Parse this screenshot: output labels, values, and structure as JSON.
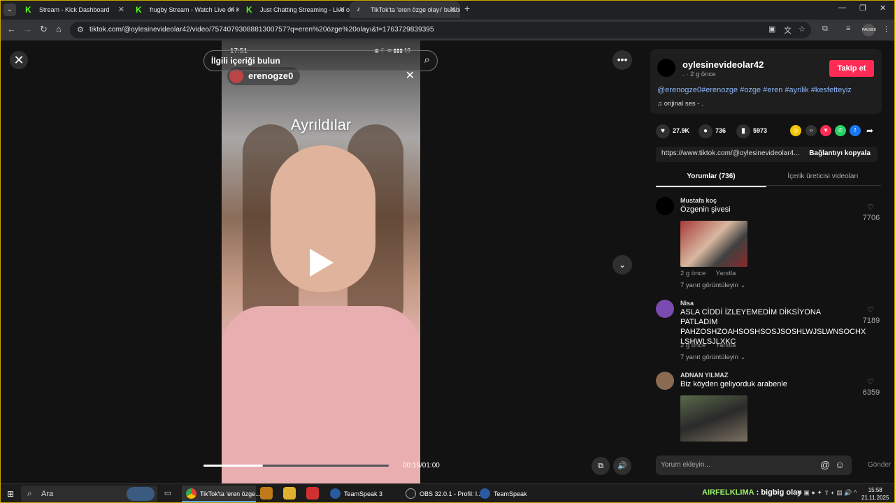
{
  "browser": {
    "tabs": [
      {
        "title": "Stream - Kick Dashboard",
        "icon": "kick-icon"
      },
      {
        "title": "frugby Stream - Watch Live on Kick",
        "icon": "kick-icon"
      },
      {
        "title": "Just Chatting Streaming - Live on Kick",
        "icon": "kick-icon"
      },
      {
        "title": "TikTok'ta 'eren özge olayı' bulabilirsin",
        "icon": "tiktok-icon",
        "active": true
      }
    ],
    "url": "tiktok.com/@oylesinevideolar42/video/7574079308881300757?q=eren%20özge%20olayı&t=1763729839395",
    "profile_label": "PAUSED"
  },
  "video": {
    "search_placeholder": "İlgili içeriği bulun",
    "phone_time": "17:51",
    "phone_battery": "19",
    "creator_tag": "erenogze0",
    "caption": "Ayrıldılar",
    "time_display": "00:19/01:00",
    "progress": 0.32
  },
  "post": {
    "author": "oylesinevideolar42",
    "meta": ". · 2 g önce",
    "follow_label": "Takip et",
    "hashtags": "@erenogze0#erenozge #ozge #eren #ayrilik #kesfetteyiz",
    "music": "orijinal ses - .",
    "likes": "27.9K",
    "comments": "736",
    "saves": "5973",
    "link": "https://www.tiktok.com/@oylesinevideolar4...",
    "copy_label": "Bağlantıyı kopyala",
    "tab_comments": "Yorumlar (736)",
    "tab_creator": "İçerik üreticisi videoları",
    "share_colors": [
      "#f5c400",
      "#333333",
      "#fe2c55",
      "#25d366",
      "#1877f2"
    ]
  },
  "comments": [
    {
      "user": "Mustafa koç",
      "text": "Özgenin şivesi",
      "likes": "7706",
      "time": "2 g önce",
      "reply_label": "Yanıtla",
      "replies": "7 yanıt görüntüleyin",
      "avatar_color": "#000000",
      "has_image": true
    },
    {
      "user": "Nisa",
      "text": "ASLA CİDDİ İZLEYEMEDİM DİKSİYONA PATLADIM PAHZOSHZOAHSOSHSOSJSOSHLWJSLWNSOCHX LSHWLSJLXKC",
      "likes": "7189",
      "time": "2 g önce",
      "reply_label": "Yanıtla",
      "replies": "7 yanıt görüntüleyin",
      "avatar_color": "#7a4ab0",
      "has_image": false
    },
    {
      "user": "ADNAN YILMAZ",
      "text": "Biz köyden geliyorduk arabenle",
      "likes": "6359",
      "avatar_color": "#8a6a50",
      "has_image": true
    }
  ],
  "comment_box": {
    "placeholder": "Yorum ekleyin...",
    "send_label": "Gönder"
  },
  "taskbar": {
    "search_placeholder": "Ara",
    "apps": [
      {
        "label": "TikTok'ta 'eren özge...",
        "icon": "chrome-icon",
        "active": true
      },
      {
        "label": "TeamSpeak 3",
        "icon": "teamspeak-icon"
      },
      {
        "label": "OBS 32.0.1 - Profil: l...",
        "icon": "obs-icon"
      },
      {
        "label": "TeamSpeak",
        "icon": "teamspeak-icon"
      }
    ],
    "ticker_brand": "AIRFELKLIMA",
    "ticker_text": ": bigbig olay",
    "time": "15:58",
    "date": "21.11.2025"
  }
}
